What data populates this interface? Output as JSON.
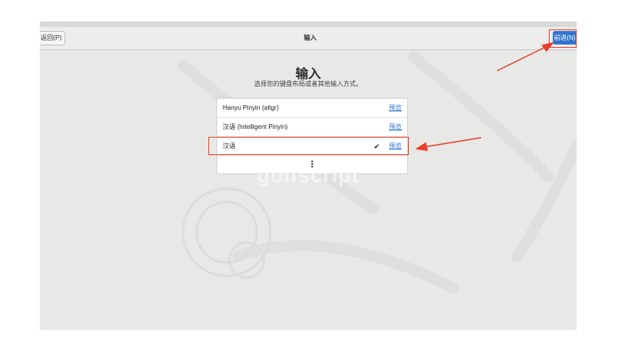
{
  "header": {
    "back_label": "返回(P)",
    "title": "输入",
    "next_label": "前进(N)"
  },
  "main": {
    "title": "输入",
    "subtitle": "选择您的键盘布局或者其他输入方式。",
    "items": [
      {
        "label": "Hanyu Pinyin (altgr)",
        "preview": "预览",
        "selected": false
      },
      {
        "label": "汉语 (Intelligent Pinyin)",
        "preview": "预览",
        "selected": false
      },
      {
        "label": "汉语",
        "preview": "预览",
        "selected": true,
        "check": "✔"
      }
    ],
    "more_icon": "vertical-ellipsis-icon"
  },
  "watermark": "golfscript",
  "annotations": {
    "highlight_color": "#e8402a"
  }
}
